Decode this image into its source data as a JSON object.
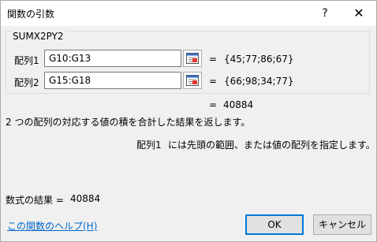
{
  "window": {
    "title": "関数の引数",
    "help_label": "?",
    "close_label": "✕"
  },
  "function": {
    "name": "SUMX2PY2",
    "args": [
      {
        "label": "配列1",
        "value": "G10:G13",
        "result": "{45;77;86;67}"
      },
      {
        "label": "配列2",
        "value": "G15:G18",
        "result": "{66;98;34;77}"
      }
    ],
    "result_eq": "=",
    "result_value": "40884",
    "description": "2 つの配列の対応する値の積を合計した結果を返します。",
    "arg_help_label": "配列1",
    "arg_help_text": "には先頭の範囲、または値の配列を指定します。"
  },
  "formula_result": {
    "label": "数式の結果 =",
    "value": "40884"
  },
  "help_link": "この関数のヘルプ(H)",
  "buttons": {
    "ok": "OK",
    "cancel": "キャンセル"
  },
  "icons": {
    "ref": "collapse-dialog-icon"
  }
}
